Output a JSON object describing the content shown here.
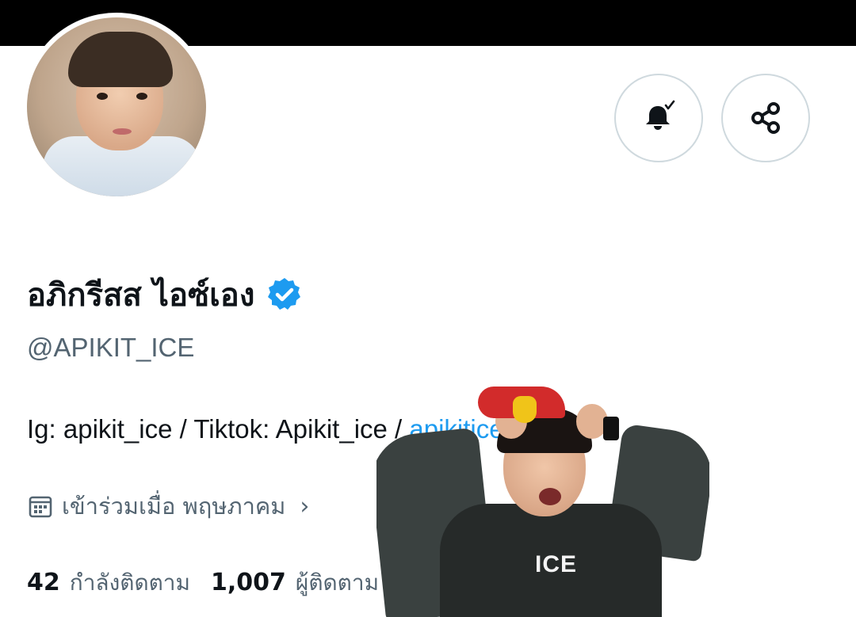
{
  "profile": {
    "display_name": "อภิกรีสส ไอซ์เอง",
    "handle": "@APIKIT_ICE",
    "bio_text": "Ig: apikit_ice / Tiktok: Apikit_ice / ",
    "bio_link": "apikiticeza67",
    "joined_label": "เข้าร่วมเมื่อ พฤษภาคม",
    "following_count": "42",
    "following_label": "กำลังติดตาม",
    "followers_count": "1,007",
    "followers_label": "ผู้ติดตาม"
  },
  "sticker": {
    "shirt_text": "ICE"
  },
  "icons": {
    "notification": "bell-check-icon",
    "share": "share-icon",
    "verified": "verified-badge-icon",
    "calendar": "calendar-icon",
    "chevron": "chevron-right-icon"
  },
  "colors": {
    "accent": "#1d9bf0",
    "secondary_text": "#536471",
    "primary_text": "#0f1419",
    "banner": "#000000"
  }
}
